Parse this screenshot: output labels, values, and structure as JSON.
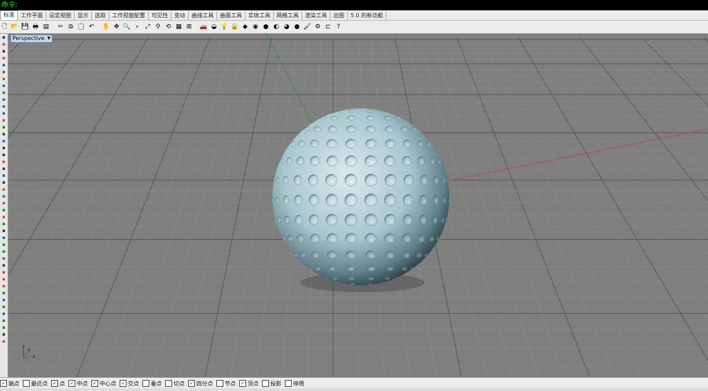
{
  "command_line": {
    "text": "命令:"
  },
  "tabs": [
    {
      "label": "标准",
      "active": true
    },
    {
      "label": "工作平面"
    },
    {
      "label": "设定视图"
    },
    {
      "label": "显示"
    },
    {
      "label": "选取"
    },
    {
      "label": "工作视窗配置"
    },
    {
      "label": "可见性"
    },
    {
      "label": "变动"
    },
    {
      "label": "曲线工具"
    },
    {
      "label": "曲面工具"
    },
    {
      "label": "实体工具"
    },
    {
      "label": "网格工具"
    },
    {
      "label": "渲染工具"
    },
    {
      "label": "出图"
    },
    {
      "label": "5.0 的新功能"
    }
  ],
  "toolbar_icons": [
    {
      "name": "new-file-icon",
      "glyph": "🗋"
    },
    {
      "name": "open-file-icon",
      "glyph": "📂"
    },
    {
      "name": "save-icon",
      "glyph": "💾"
    },
    {
      "name": "print-icon",
      "glyph": "🖶"
    },
    {
      "name": "import-icon",
      "glyph": "▤"
    },
    {
      "name": "cut-icon",
      "glyph": "✂"
    },
    {
      "name": "copy-icon",
      "glyph": "⧉"
    },
    {
      "name": "paste-icon",
      "glyph": "📋"
    },
    {
      "name": "undo-icon",
      "glyph": "↶"
    },
    {
      "name": "pan-hand-icon",
      "glyph": "✋"
    },
    {
      "name": "move-view-icon",
      "glyph": "✥"
    },
    {
      "name": "zoom-icon",
      "glyph": "🔍"
    },
    {
      "name": "zoom-window-icon",
      "glyph": "⌕"
    },
    {
      "name": "zoom-extents-icon",
      "glyph": "⤢"
    },
    {
      "name": "zoom-selected-icon",
      "glyph": "⚲"
    },
    {
      "name": "rotate-view-icon",
      "glyph": "⟲"
    },
    {
      "name": "grid-icon",
      "glyph": "▦"
    },
    {
      "name": "set-cplane-icon",
      "glyph": "⊞"
    },
    {
      "name": "car-render-icon",
      "glyph": "🚗"
    },
    {
      "name": "surface-icon",
      "glyph": "◒"
    },
    {
      "name": "light-icon",
      "glyph": "💡"
    },
    {
      "name": "lock-icon",
      "glyph": "🔒"
    },
    {
      "name": "layer-icon",
      "glyph": "◆"
    },
    {
      "name": "color-wheel-icon",
      "glyph": "◉"
    },
    {
      "name": "sphere-render-icon",
      "glyph": "●"
    },
    {
      "name": "shaded-sphere-icon",
      "glyph": "◐"
    },
    {
      "name": "material-icon",
      "glyph": "◕"
    },
    {
      "name": "blue-sphere-icon",
      "glyph": "●"
    },
    {
      "name": "brush-icon",
      "glyph": "🖌"
    },
    {
      "name": "settings-gear-icon",
      "glyph": "⚙"
    },
    {
      "name": "dimension-icon",
      "glyph": "⊏"
    },
    {
      "name": "help-icon",
      "glyph": "?"
    }
  ],
  "left_tool_icons": [
    "select-arrow-icon",
    "point-icon",
    "polyline-icon",
    "curve-icon",
    "arc-icon",
    "circle-icon",
    "rectangle-icon",
    "ellipse-icon",
    "fillet-icon",
    "surface-from-curves-icon",
    "extrude-icon",
    "revolve-icon",
    "solid-box-icon",
    "sphere-icon",
    "cylinder-icon",
    "boolean-icon",
    "mesh-icon",
    "trim-icon",
    "split-icon",
    "join-icon",
    "explode-icon",
    "move-icon",
    "copy-tool-icon",
    "rotate-icon",
    "scale-icon",
    "mirror-icon",
    "array-icon",
    "dimension-tool-icon",
    "text-icon",
    "analyze-icon",
    "render-icon",
    "properties-icon",
    "layer-tool-icon",
    "snap-icon",
    "osnap-icon",
    "grid-snap-icon",
    "ortho-icon",
    "planar-icon",
    "history-icon",
    "record-icon",
    "gumball-icon",
    "cplane-icon",
    "named-view-icon",
    "display-mode-icon",
    "zebra-icon"
  ],
  "viewport": {
    "title": "Perspective",
    "axis_x_label": "x",
    "axis_y_label": "y",
    "axis_z_label": "z",
    "colors": {
      "grid_minor": "#8a8a8a",
      "grid_major": "#5a5a5a",
      "x_axis": "#b44a4a",
      "y_axis": "#3f8f3f",
      "background": "#7f7f7f",
      "sphere": "#a9c7d0"
    }
  },
  "snaps": [
    {
      "label": "端点",
      "checked": true
    },
    {
      "label": "最近点",
      "checked": false
    },
    {
      "label": "点",
      "checked": true
    },
    {
      "label": "中点",
      "checked": true
    },
    {
      "label": "中心点",
      "checked": true
    },
    {
      "label": "交点",
      "checked": true
    },
    {
      "label": "垂点",
      "checked": false
    },
    {
      "label": "切点",
      "checked": false
    },
    {
      "label": "四分点",
      "checked": true
    },
    {
      "label": "节点",
      "checked": false
    },
    {
      "label": "顶点",
      "checked": true
    },
    {
      "label": "投影",
      "checked": false
    },
    {
      "label": "停用",
      "checked": false
    }
  ]
}
